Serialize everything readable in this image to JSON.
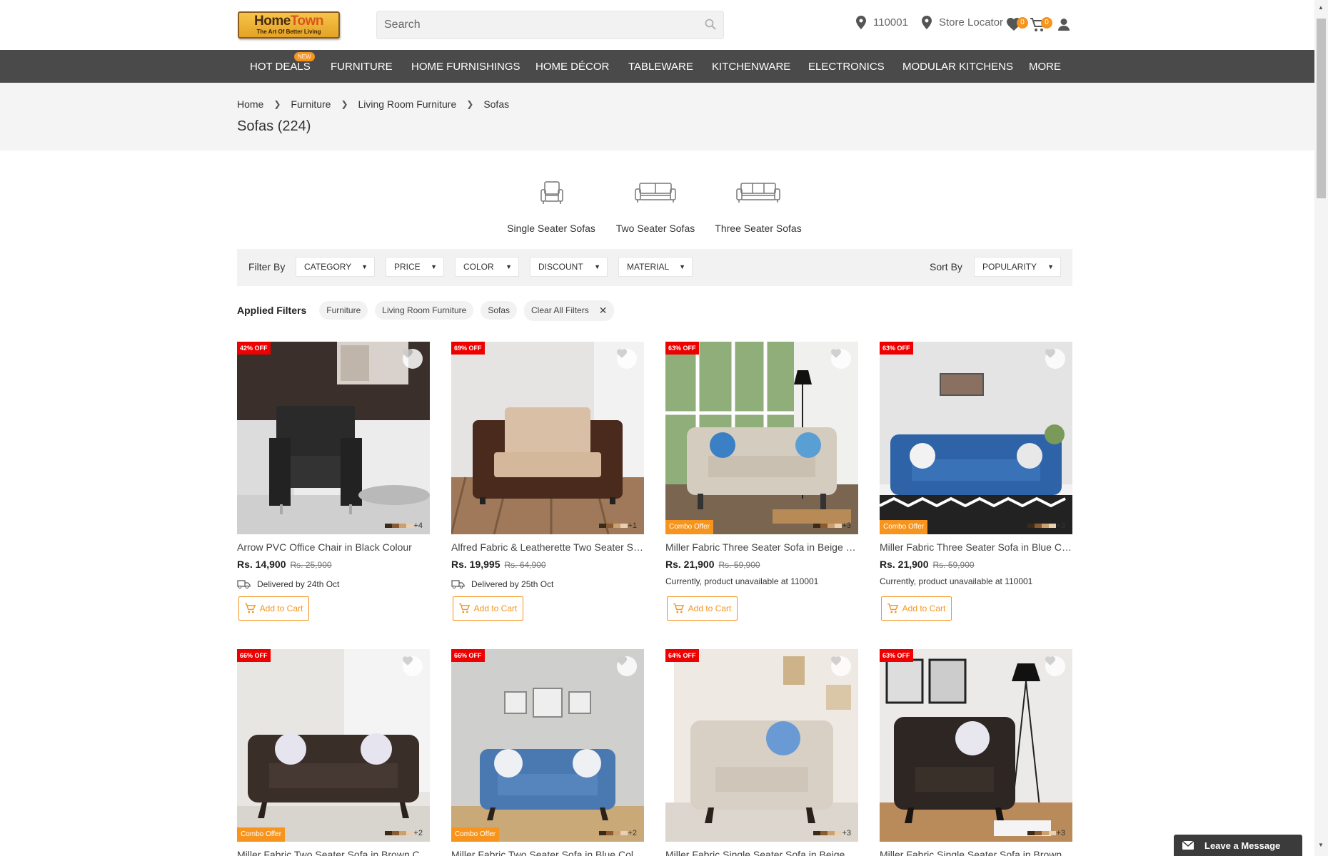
{
  "header": {
    "logo_text_a": "Home",
    "logo_text_b": "Town",
    "logo_tagline": "The Art Of Better Living",
    "search_placeholder": "Search",
    "pincode": "110001",
    "store_locator": "Store Locator",
    "wishlist_count": "0",
    "cart_count": "0"
  },
  "nav": {
    "new_badge": "NEW",
    "items": [
      "HOT DEALS",
      "FURNITURE",
      "HOME FURNISHINGS",
      "HOME DÉCOR",
      "TABLEWARE",
      "KITCHENWARE",
      "ELECTRONICS",
      "MODULAR KITCHENS",
      "MORE"
    ]
  },
  "breadcrumb": [
    "Home",
    "Furniture",
    "Living Room Furniture",
    "Sofas"
  ],
  "page_title": "Sofas (224)",
  "categories": [
    "Single Seater Sofas",
    "Two Seater Sofas",
    "Three Seater Sofas"
  ],
  "filters": {
    "filter_by": "Filter By",
    "dropdowns": [
      "CATEGORY",
      "PRICE",
      "COLOR",
      "DISCOUNT",
      "MATERIAL"
    ],
    "sort_by": "Sort By",
    "sort_value": "POPULARITY"
  },
  "applied": {
    "label": "Applied Filters",
    "chips": [
      "Furniture",
      "Living Room Furniture",
      "Sofas"
    ],
    "clear": "Clear All Filters"
  },
  "products": [
    {
      "name": "Arrow PVC Office Chair in Black Colour",
      "discount": "42% OFF",
      "price": "Rs. 14,900",
      "mrp": "Rs. 25,900",
      "delivery": "Delivered by 24th Oct",
      "more_colors": "+4",
      "combo": ""
    },
    {
      "name": "Alfred Fabric & Leatherette Two Seater Sofa",
      "discount": "69% OFF",
      "price": "Rs. 19,995",
      "mrp": "Rs. 64,900",
      "delivery": "Delivered by 25th Oct",
      "more_colors": "+1",
      "combo": ""
    },
    {
      "name": "Miller Fabric Three Seater Sofa in Beige Colour",
      "discount": "63% OFF",
      "price": "Rs. 21,900",
      "mrp": "Rs. 59,900",
      "unavailable": "Currently, product unavailable at 110001",
      "more_colors": "+3",
      "combo": "Combo Offer"
    },
    {
      "name": "Miller Fabric Three Seater Sofa in Blue Colour",
      "discount": "63% OFF",
      "price": "Rs. 21,900",
      "mrp": "Rs. 59,900",
      "unavailable": "Currently, product unavailable at 110001",
      "more_colors": "+3",
      "combo": "Combo Offer"
    },
    {
      "name": "Miller Fabric Two Seater Sofa in Brown Colour",
      "discount": "66% OFF",
      "more_colors": "+2",
      "combo": "Combo Offer"
    },
    {
      "name": "Miller Fabric Two Seater Sofa in Blue Colour",
      "discount": "66% OFF",
      "more_colors": "+2",
      "combo": "Combo Offer"
    },
    {
      "name": "Miller Fabric Single Seater Sofa in Beige Colour",
      "discount": "64% OFF",
      "more_colors": "+3",
      "combo": ""
    },
    {
      "name": "Miller Fabric Single Seater Sofa in Brown Colour",
      "discount": "63% OFF",
      "more_colors": "+3",
      "combo": ""
    }
  ],
  "add_to_cart": "Add to Cart",
  "chat": "Leave a Message",
  "colors": {
    "accent": "#f7941d",
    "nav_bg": "#4a4a4a",
    "discount_red": "#e00000"
  }
}
